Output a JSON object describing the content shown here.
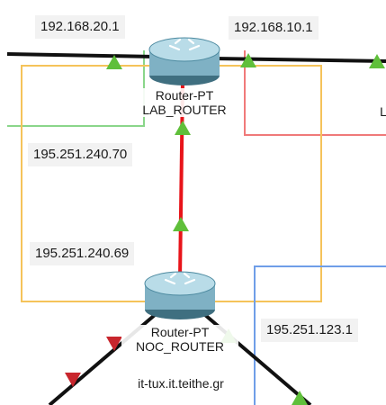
{
  "address_labels": {
    "lab_left": "192.168.20.1",
    "lab_right": "192.168.10.1",
    "lab_bottom": "195.251.240.70",
    "noc_top": "195.251.240.69",
    "noc_right": "195.251.123.1"
  },
  "devices": {
    "lab_router": {
      "model": "Router-PT",
      "name": "LAB_ROUTER"
    },
    "noc_router": {
      "model": "Router-PT",
      "name": "NOC_ROUTER"
    }
  },
  "host_label": "it-tux.it.teithe.gr",
  "partial_label": "L",
  "colors": {
    "serial_link": "#e8141a",
    "ethernet_link": "#111111",
    "area_yellow": "#f5c35a",
    "area_green": "#8ad68a",
    "area_red": "#f07a7a",
    "area_blue": "#6f9ee8",
    "port_up": "#5fbf3a",
    "port_down": "#c8262d",
    "router_body": "#7fb1c4"
  }
}
